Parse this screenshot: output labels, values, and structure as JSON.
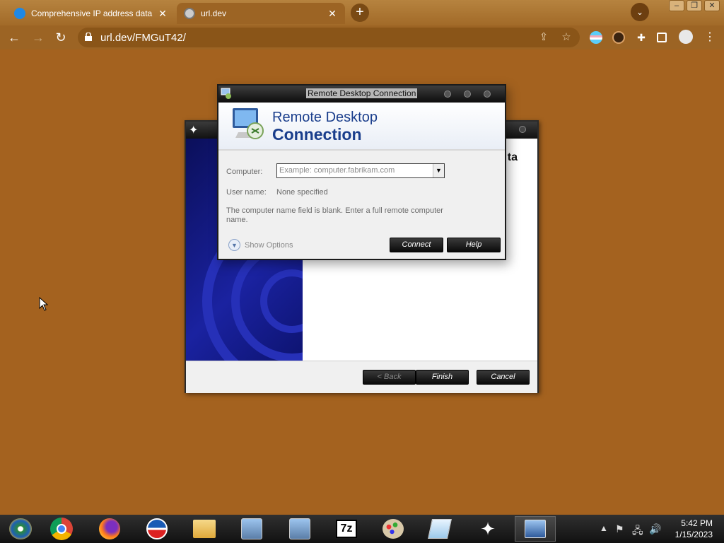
{
  "browser": {
    "tabs": [
      {
        "title": "Comprehensive IP address data, I",
        "active": false
      },
      {
        "title": "url.dev",
        "active": true
      }
    ],
    "url": "url.dev/FMGuT42/"
  },
  "installer": {
    "heading_fragment": "ta",
    "back_label": "< Back",
    "finish_label": "Finish",
    "cancel_label": "Cancel"
  },
  "rdc": {
    "window_title": "Remote Desktop Connection",
    "banner_line1": "Remote Desktop",
    "banner_line2": "Connection",
    "computer_label": "Computer:",
    "computer_placeholder": "Example: computer.fabrikam.com",
    "username_label": "User name:",
    "username_value": "None specified",
    "message": "The computer name field is blank.  Enter a full remote computer name.",
    "show_options_label": "Show Options",
    "connect_label": "Connect",
    "help_label": "Help"
  },
  "taskbar": {
    "apps": [
      "windows-media-center",
      "chrome",
      "firefox",
      "obama-logo",
      "file-explorer",
      "installer-cd",
      "installer-cd-2",
      "7-zip",
      "paint",
      "notepad",
      "app-shuriken",
      "remote-desktop"
    ],
    "time": "5:42 PM",
    "date": "1/15/2023"
  },
  "colors": {
    "desktop": "#a4621f",
    "rdc_blue": "#1a3e8c"
  }
}
